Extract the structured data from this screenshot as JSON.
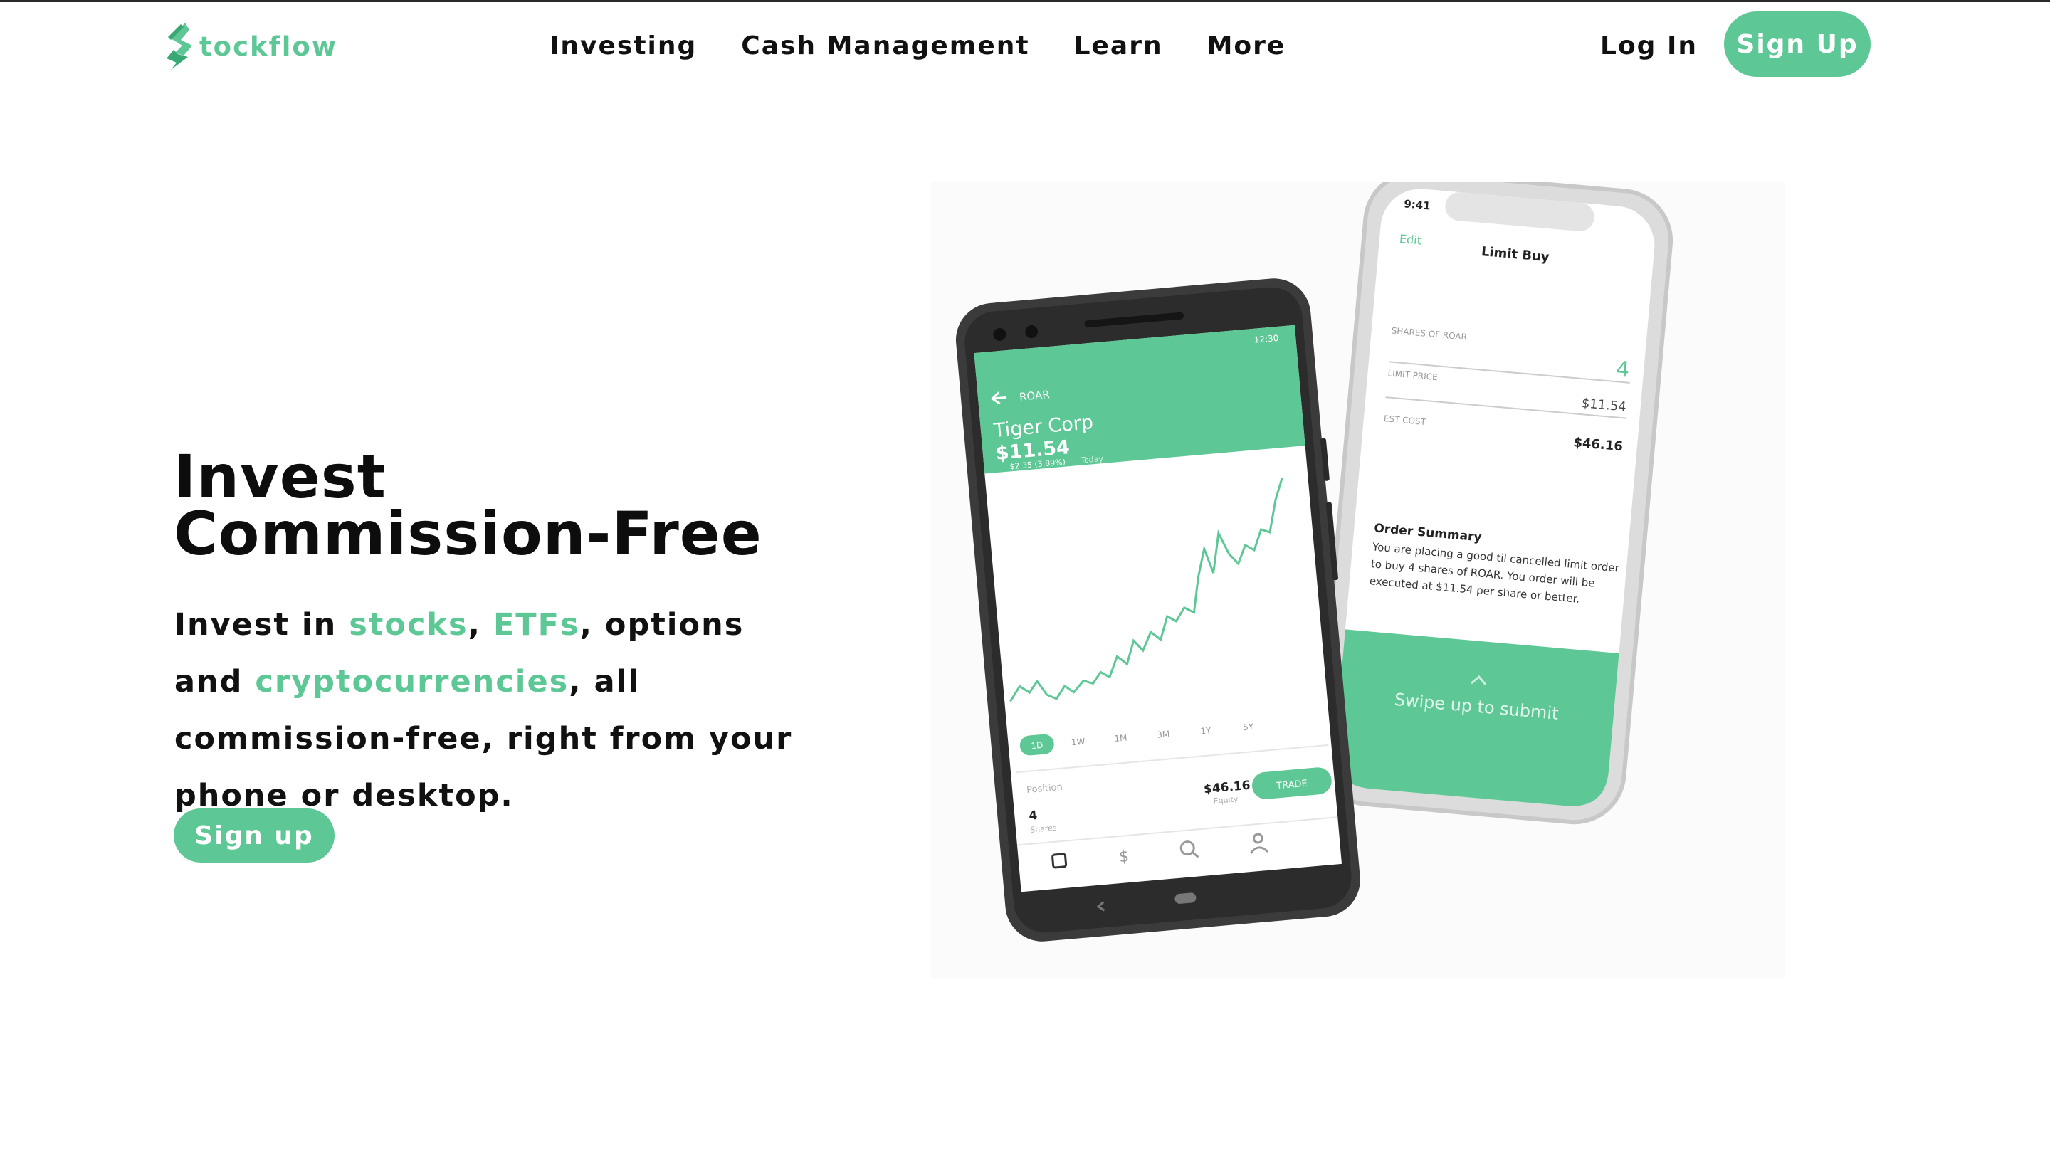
{
  "brand": {
    "name": "Stockflow",
    "logo_text": "tockflow",
    "accent_color": "#5ec796"
  },
  "nav": {
    "items": [
      "Investing",
      "Cash Management",
      "Learn",
      "More"
    ],
    "login_label": "Log In",
    "signup_label": "Sign Up"
  },
  "hero": {
    "headline_line1": "Invest",
    "headline_line2": "Commission-Free",
    "sub_part1": "Invest in ",
    "sub_stocks": "stocks",
    "sub_part2": ", ",
    "sub_etfs": "ETFs",
    "sub_part3": ", options and ",
    "sub_crypto": "cryptocurrencies",
    "sub_part4": ", all commission-free, right from your phone or desktop.",
    "cta_label": "Sign up"
  },
  "phone_android": {
    "status_time": "12:30",
    "ticker": "ROAR",
    "company": "Tiger Corp",
    "price": "$11.54",
    "change": "$2.35 (3.89%)",
    "change_period": "Today",
    "ranges": [
      "1D",
      "1W",
      "1M",
      "3M",
      "1Y",
      "5Y"
    ],
    "position_label": "Position",
    "shares_value": "4",
    "shares_label": "Shares",
    "equity_value": "$46.16",
    "equity_label": "Equity",
    "trade_label": "TRADE"
  },
  "phone_iphone": {
    "status_time": "9:41",
    "edit_label": "Edit",
    "title": "Limit Buy",
    "shares_label": "SHARES OF ROAR",
    "shares_value": "4",
    "limit_label": "LIMIT PRICE",
    "limit_value": "$11.54",
    "est_label": "EST COST",
    "est_value": "$46.16",
    "summary_title": "Order Summary",
    "summary_line1": "You are placing a good til cancelled limit order",
    "summary_line2": "to buy 4 shares of ROAR. You order will be",
    "summary_line3": "executed at $11.54 per share or better.",
    "swipe_label": "Swipe up to submit"
  }
}
